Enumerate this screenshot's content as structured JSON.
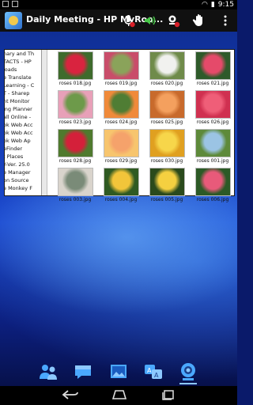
{
  "status_bar": {
    "time": "9:15"
  },
  "header": {
    "title": "Daily Meeting - HP MyRoo..."
  },
  "shared_window": {
    "left_pane_items": [
      "nary and Th",
      "TACTS - HP",
      "loads",
      "e Translate",
      "Learning - C",
      "T - Sharep",
      "nt Monitor",
      "ing Planner",
      "all Online -",
      "ok Web Acc",
      "ok Web Acc",
      "ok Web Ap",
      "eFinder",
      "t Places",
      "Y-Ver. 25.0",
      "e Manager",
      "on Source",
      "e Monkey F"
    ],
    "thumbnails": [
      {
        "caption": "roses 018.jpg",
        "c1": "#d9233f",
        "c2": "#3e6b2c"
      },
      {
        "caption": "roses 019.jpg",
        "c1": "#8aa35a",
        "c2": "#c94d6a"
      },
      {
        "caption": "roses 020.jpg",
        "c1": "#f1f1ef",
        "c2": "#6f8b4a"
      },
      {
        "caption": "roses 021.jpg",
        "c1": "#e54a6a",
        "c2": "#2e5a2a"
      },
      {
        "caption": "roses 023.jpg",
        "c1": "#6d9a4a",
        "c2": "#e8a0b8"
      },
      {
        "caption": "roses 024.jpg",
        "c1": "#4f7d34",
        "c2": "#f08a3a"
      },
      {
        "caption": "roses 025.jpg",
        "c1": "#f4a05e",
        "c2": "#c86a2c"
      },
      {
        "caption": "roses 026.jpg",
        "c1": "#ef5e78",
        "c2": "#d03050"
      },
      {
        "caption": "roses 028.jpg",
        "c1": "#d4203a",
        "c2": "#4f7a2e"
      },
      {
        "caption": "roses 029.jpg",
        "c1": "#f5a26b",
        "c2": "#f7c56e"
      },
      {
        "caption": "roses 030.jpg",
        "c1": "#f7d64a",
        "c2": "#e0a020"
      },
      {
        "caption": "roses 001.jpg",
        "c1": "#9bc4e4",
        "c2": "#5e8a3a"
      },
      {
        "caption": "roses 003.jpg",
        "c1": "#7a8b78",
        "c2": "#d9d4cc"
      },
      {
        "caption": "roses 004.jpg",
        "c1": "#f2c53a",
        "c2": "#2f5a22"
      },
      {
        "caption": "roses 005.jpg",
        "c1": "#f5d040",
        "c2": "#2a4a1c"
      },
      {
        "caption": "roses 006.jpg",
        "c1": "#e85a7a",
        "c2": "#2c5a26"
      }
    ]
  },
  "icons": {
    "microphone": "microphone-icon",
    "speaker": "speaker-icon",
    "webcam": "webcam-icon",
    "hand": "raise-hand-icon",
    "overflow": "overflow-menu-icon",
    "people": "people-icon",
    "chat": "chat-icon",
    "content": "content-icon",
    "translate": "translate-icon",
    "camera": "camera-icon",
    "back": "back-icon",
    "home": "home-icon",
    "recent": "recent-apps-icon"
  },
  "colors": {
    "accent_green": "#49c84a",
    "alert_red": "#d8202a",
    "title_bar": "#101010",
    "bottom_icon_blue": "#4aa8ff"
  }
}
